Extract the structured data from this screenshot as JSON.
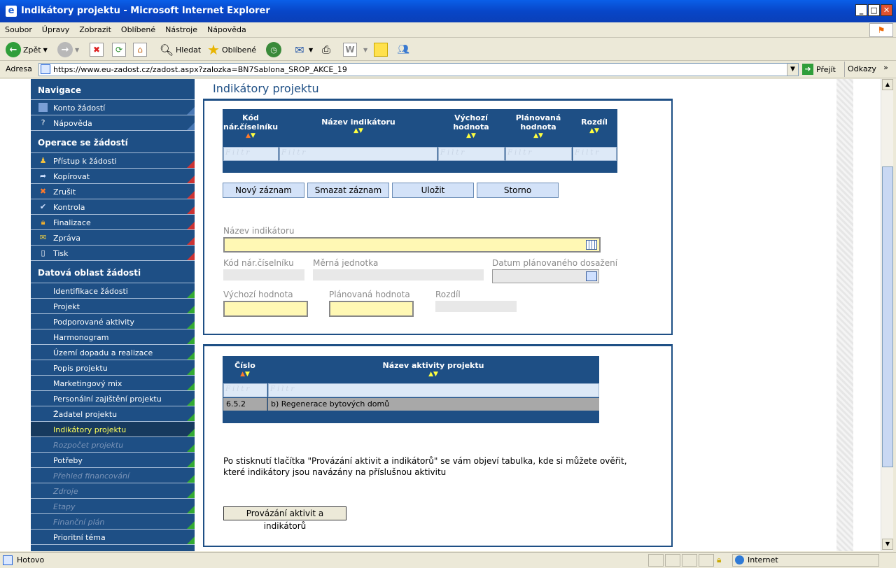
{
  "window": {
    "title": "Indikátory projektu - Microsoft Internet Explorer",
    "minimize": "_",
    "maximize": "□",
    "close": "✕"
  },
  "menu": [
    "Soubor",
    "Úpravy",
    "Zobrazit",
    "Oblíbené",
    "Nástroje",
    "Nápověda"
  ],
  "toolbar": {
    "back": "Zpět",
    "search": "Hledat",
    "favorites": "Oblíbené"
  },
  "address": {
    "label": "Adresa",
    "url": "https://www.eu-zadost.cz/zadost.aspx?zalozka=BN7Sablona_SROP_AKCE_19",
    "go": "Přejít",
    "links": "Odkazy"
  },
  "status": {
    "text": "Hotovo",
    "zone": "Internet"
  },
  "sidebar": {
    "nav_header": "Navigace",
    "nav_items": [
      "Konto žádostí",
      "Nápověda"
    ],
    "ops_header": "Operace se žádostí",
    "ops_items": [
      "Přístup k žádosti",
      "Kopírovat",
      "Zrušit",
      "Kontrola",
      "Finalizace",
      "Zpráva",
      "Tisk"
    ],
    "data_header": "Datová oblast žádosti",
    "data_items": [
      "Identifikace žádosti",
      "Projekt",
      "Podporované aktivity",
      "Harmonogram",
      "Území dopadu a realizace",
      "Popis projektu",
      "Marketingový mix",
      "Personální zajištění projektu",
      "Žadatel projektu",
      "Indikátory projektu",
      "Rozpočet projektu",
      "Potřeby",
      "Přehled financování",
      "Zdroje",
      "Etapy",
      "Finanční plán",
      "Prioritní téma"
    ]
  },
  "page_title": "Indikátory projektu",
  "grid1": {
    "col1": "Kód",
    "col1b": "nár.číselníku",
    "col2": "Název indikátoru",
    "col3": "Výchozí",
    "col3b": "hodnota",
    "col4": "Plánovaná",
    "col4b": "hodnota",
    "col5": "Rozdíl",
    "filter": "Filtr"
  },
  "buttons": {
    "new": "Nový záznam",
    "delete": "Smazat záznam",
    "save": "Uložit",
    "cancel": "Storno"
  },
  "form": {
    "name_label": "Název indikátoru",
    "code_label": "Kód nár.číselníku",
    "unit_label": "Měrná jednotka",
    "date_label": "Datum plánovaného dosažení",
    "start_label": "Výchozí hodnota",
    "planned_label": "Plánovaná hodnota",
    "diff_label": "Rozdíl"
  },
  "grid2": {
    "col1": "Číslo",
    "col2": "Název aktivity projektu",
    "filter": "Filtr",
    "rows": [
      {
        "num": "6.5.2",
        "name": "b) Regenerace bytových domů"
      }
    ]
  },
  "info_line1": "Po stisknutí tlačítka \"Provázání aktivit a indikátorů\" se vám objeví tabulka, kde si můžete ověřit,",
  "info_line2": "které indikátory jsou navázány na příslušnou aktivitu",
  "link_button": "Provázání aktivit a indikátorů"
}
